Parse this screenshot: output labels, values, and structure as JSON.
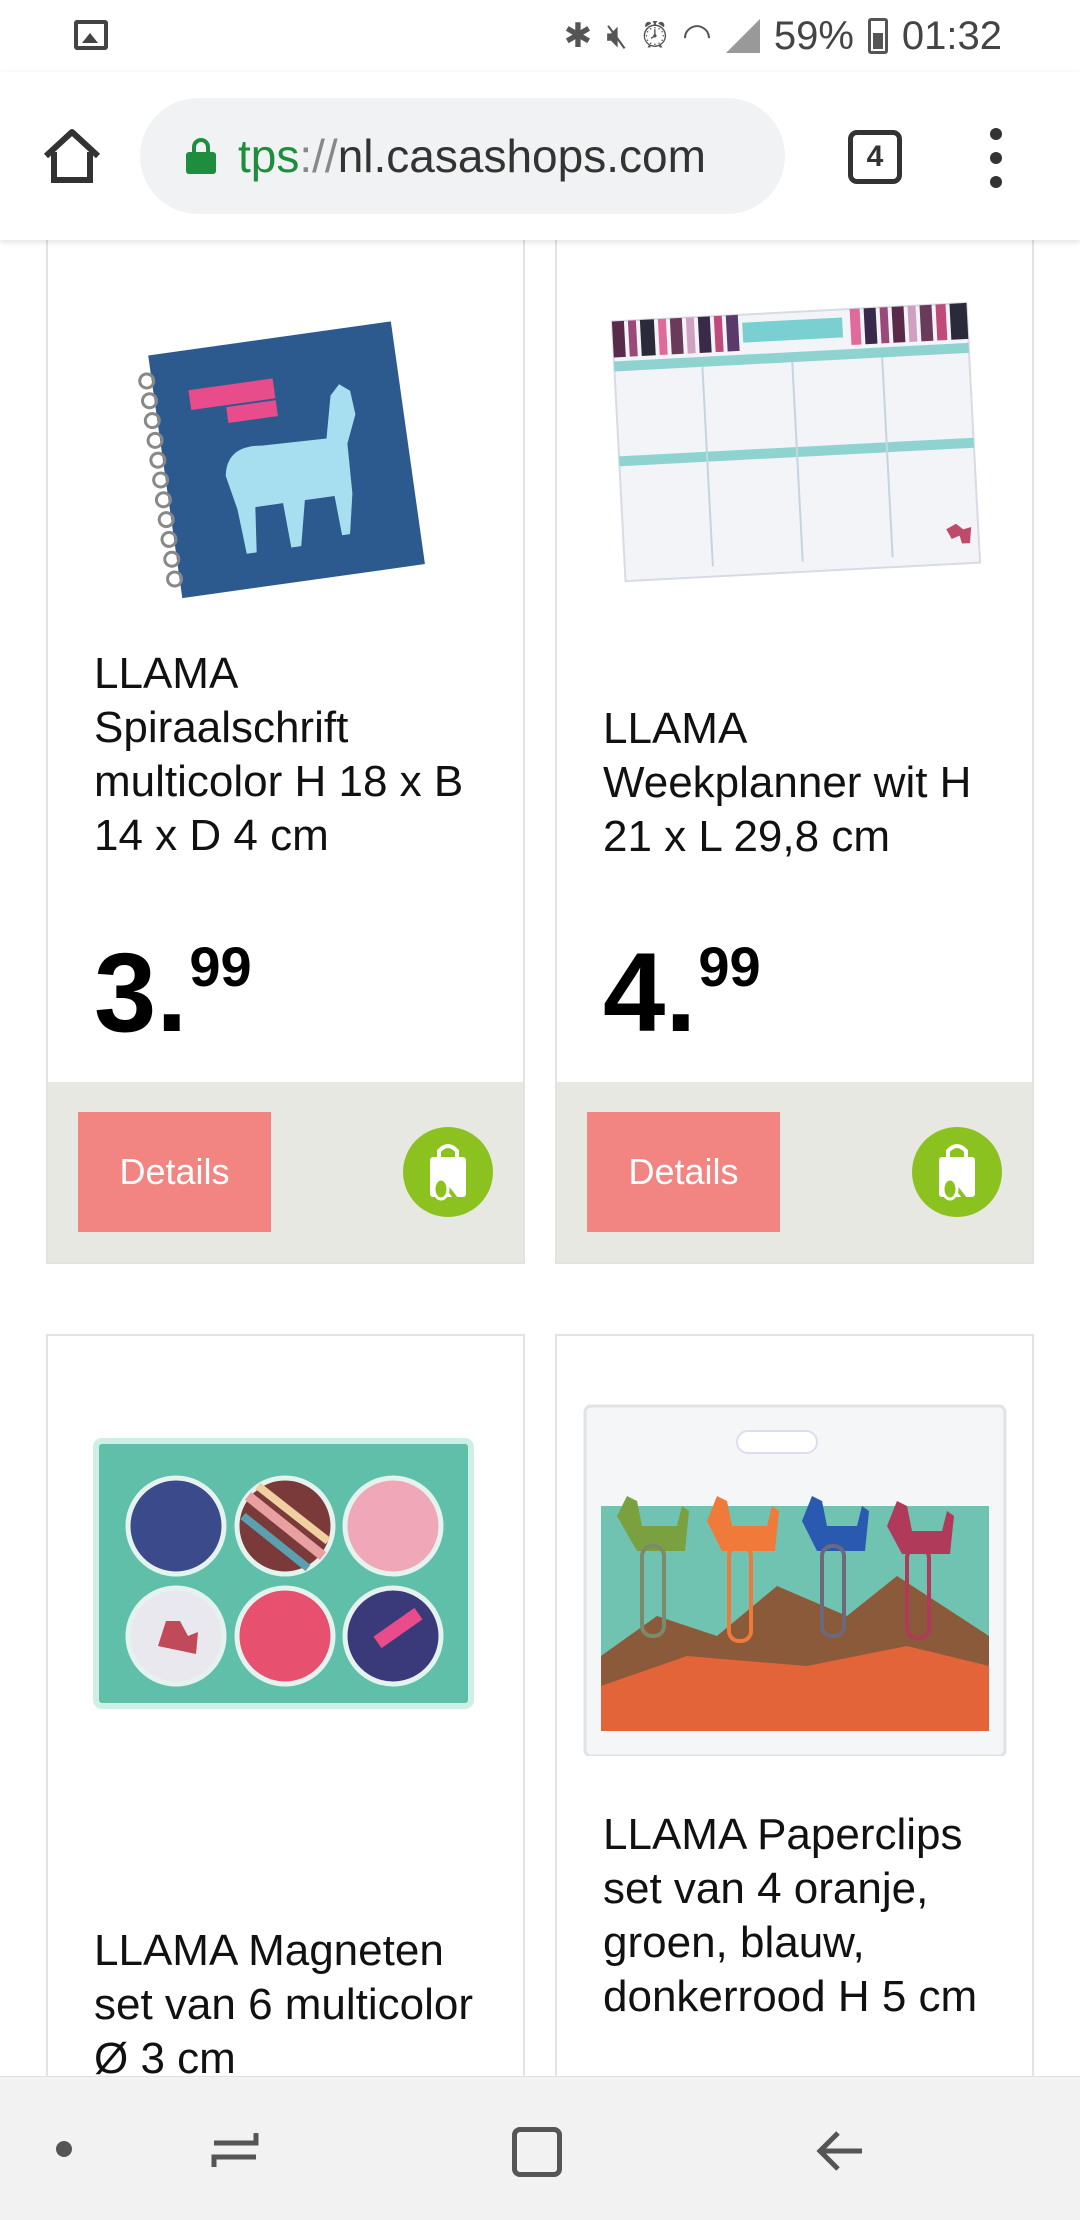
{
  "status_bar": {
    "battery": "59%",
    "time": "01:32",
    "icons": [
      "gallery-icon",
      "bluetooth-icon",
      "mute-icon",
      "alarm-icon",
      "wifi-icon",
      "signal-icon",
      "battery-icon"
    ]
  },
  "browser": {
    "url_scheme": "tps",
    "url_separator": "://",
    "url_host": "nl.casashops.com",
    "tab_count": "4",
    "accent_color": "#1e8e3e"
  },
  "products": [
    {
      "title": "LLAMA Spiraalschrift multicolor H 18 x B 14 x D 4 cm",
      "price_int": "3.",
      "price_dec": "99",
      "details_label": "Details"
    },
    {
      "title": "LLAMA Weekplanner wit H 21 x L 29,8 cm",
      "price_int": "4.",
      "price_dec": "99",
      "details_label": "Details"
    },
    {
      "title": "LLAMA Magneten set van 6 multicolor Ø 3 cm"
    },
    {
      "title": "LLAMA Paperclips set van 4 oranje, groen, blauw, donkerrood H 5 cm"
    }
  ],
  "colors": {
    "details_button": "#f28482",
    "cart_button": "#8cc21f",
    "action_bar": "#e8e8e3"
  }
}
